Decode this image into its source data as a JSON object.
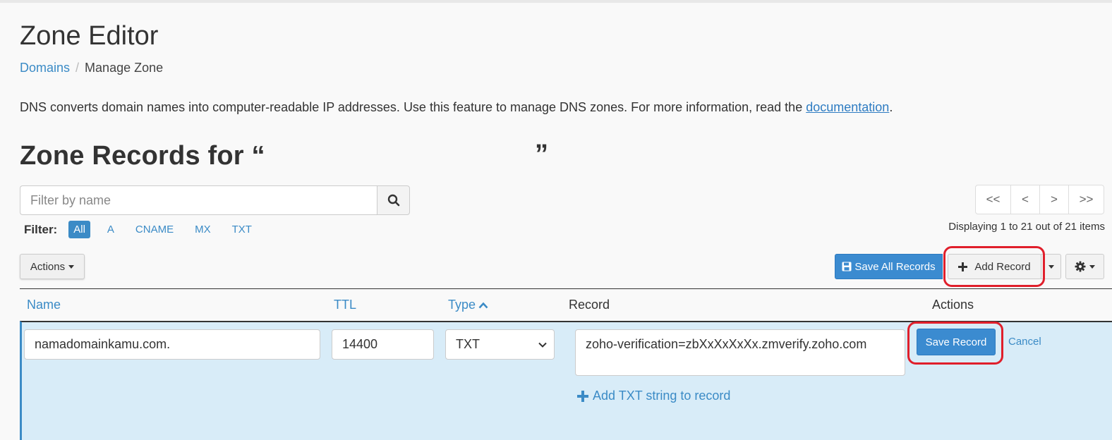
{
  "page": {
    "title": "Zone Editor",
    "breadcrumb": {
      "link": "Domains",
      "separator": "/",
      "current": "Manage Zone"
    },
    "intro_text": "DNS converts domain names into computer-readable IP addresses. Use this feature to manage DNS zones. For more information, read the ",
    "intro_link": "documentation",
    "intro_end": ".",
    "section_title_open": "Zone Records for “",
    "section_title_close": "”"
  },
  "search": {
    "placeholder": "Filter by name"
  },
  "pagination": {
    "buttons": [
      "<<",
      "<",
      ">",
      ">>"
    ],
    "status": "Displaying 1 to 21 out of 21 items"
  },
  "filter": {
    "label": "Filter:",
    "options": [
      "All",
      "A",
      "CNAME",
      "MX",
      "TXT"
    ],
    "active": "All"
  },
  "toolbar": {
    "actions_label": "Actions",
    "save_all_label": "Save All Records",
    "add_record_label": "Add Record"
  },
  "table": {
    "columns": [
      "Name",
      "TTL",
      "Type",
      "Record",
      "Actions"
    ]
  },
  "edit_row": {
    "name": "namadomainkamu.com.",
    "ttl": "14400",
    "type": "TXT",
    "record": "zoho-verification=zbXxXxXxXx.zmverify.zoho.com",
    "add_txt_label": "Add TXT string to record",
    "save_label": "Save Record",
    "cancel_label": "Cancel"
  },
  "colors": {
    "primary": "#3b8bd0",
    "link": "#3b8bc6",
    "highlight": "#e01f2b",
    "edit_row_bg": "#d8ecf8"
  }
}
